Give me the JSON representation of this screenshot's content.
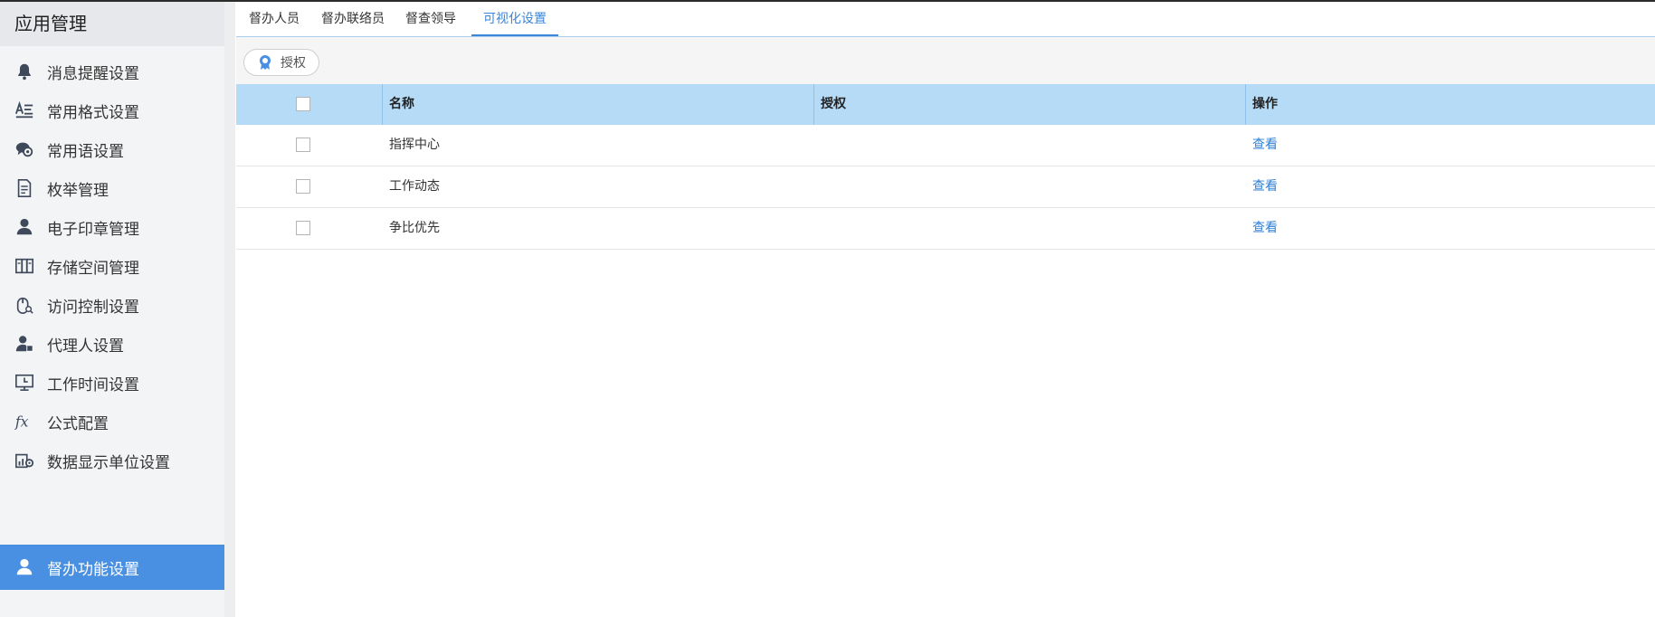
{
  "sidebar": {
    "title": "应用管理",
    "items": [
      {
        "label": "消息提醒设置",
        "icon": "bell-icon"
      },
      {
        "label": "常用格式设置",
        "icon": "text-format-icon"
      },
      {
        "label": "常用语设置",
        "icon": "speech-bubbles-icon"
      },
      {
        "label": "枚举管理",
        "icon": "document-list-icon"
      },
      {
        "label": "电子印章管理",
        "icon": "user-seal-icon"
      },
      {
        "label": "存储空间管理",
        "icon": "storage-icon"
      },
      {
        "label": "访问控制设置",
        "icon": "access-search-icon"
      },
      {
        "label": "代理人设置",
        "icon": "agent-icon"
      },
      {
        "label": "工作时间设置",
        "icon": "monitor-clock-icon"
      },
      {
        "label": "公式配置",
        "icon": "fx-icon"
      },
      {
        "label": "数据显示单位设置",
        "icon": "data-settings-icon"
      },
      {
        "label": "督办功能设置",
        "icon": "user-icon",
        "active": true
      }
    ]
  },
  "tabs": [
    {
      "label": "督办人员"
    },
    {
      "label": "督办联络员"
    },
    {
      "label": "督查领导"
    },
    {
      "label": "可视化设置",
      "active": true
    }
  ],
  "toolbar": {
    "authorize_label": "授权"
  },
  "table": {
    "headers": {
      "name": "名称",
      "auth": "授权",
      "action": "操作"
    },
    "rows": [
      {
        "name": "指挥中心",
        "auth": "",
        "action": "查看"
      },
      {
        "name": "工作动态",
        "auth": "",
        "action": "查看"
      },
      {
        "name": "争比优先",
        "auth": "",
        "action": "查看"
      }
    ]
  },
  "colors": {
    "accent": "#4a90e2",
    "header_bg": "#b6dbf6",
    "link": "#2f7fd6"
  }
}
